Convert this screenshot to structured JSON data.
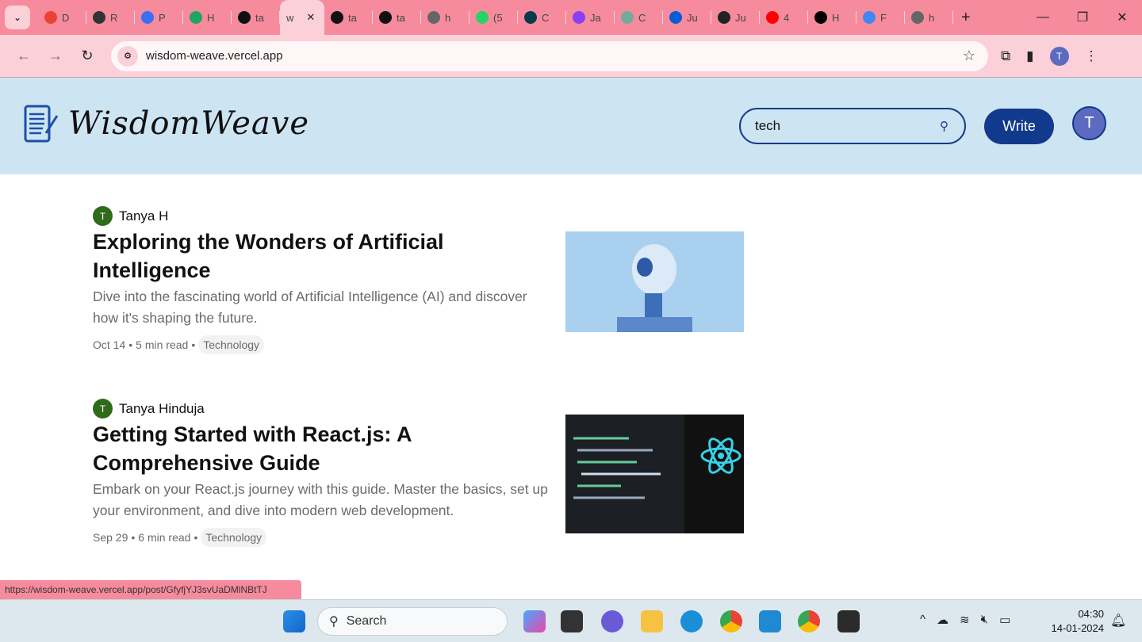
{
  "browser": {
    "tabs": [
      {
        "label": "D",
        "icon": "gmail-icon",
        "color": "#ea4335"
      },
      {
        "label": "R",
        "icon": "app-icon",
        "color": "#333333"
      },
      {
        "label": "P",
        "icon": "doc-icon",
        "color": "#3b6ef5"
      },
      {
        "label": "H",
        "icon": "google-drive-icon",
        "color": "#1fa463"
      },
      {
        "label": "ta",
        "icon": "github-icon",
        "color": "#111111"
      },
      {
        "label": "w",
        "icon": "",
        "color": "",
        "active": true
      },
      {
        "label": "ta",
        "icon": "github-icon",
        "color": "#111111"
      },
      {
        "label": "ta",
        "icon": "github-icon",
        "color": "#111111"
      },
      {
        "label": "h",
        "icon": "globe-icon",
        "color": "#666666"
      },
      {
        "label": "(5",
        "icon": "whatsapp-icon",
        "color": "#25d366"
      },
      {
        "label": "C",
        "icon": "react-icon",
        "color": "#0b3a4a"
      },
      {
        "label": "Ja",
        "icon": "app-icon",
        "color": "#8a3ff5"
      },
      {
        "label": "C",
        "icon": "chatgpt-icon",
        "color": "#74aa9c"
      },
      {
        "label": "Ju",
        "icon": "app-icon",
        "color": "#0a5bd8"
      },
      {
        "label": "Ju",
        "icon": "app-icon",
        "color": "#222222"
      },
      {
        "label": "4",
        "icon": "youtube-icon",
        "color": "#ff0000"
      },
      {
        "label": "H",
        "icon": "app-icon",
        "color": "#000000"
      },
      {
        "label": "F",
        "icon": "google-icon",
        "color": "#4285f4"
      },
      {
        "label": "h",
        "icon": "globe-icon",
        "color": "#666666"
      }
    ],
    "url": "wisdom-weave.vercel.app",
    "profile_initial": "T",
    "status_url": "https://wisdom-weave.vercel.app/post/GfyfjYJ3svUaDMlNBtTJ"
  },
  "header": {
    "logo_text": "WisdomWeave",
    "search_value": "tech",
    "write_label": "Write",
    "avatar_initial": "T"
  },
  "posts": [
    {
      "author": "Tanya H",
      "author_initial": "T",
      "title": "Exploring the Wonders of Artificial Intelligence",
      "description": "Dive into the fascinating world of Artificial Intelligence (AI) and discover how it's shaping the future.",
      "date": "Oct 14",
      "read_time": "5 min read",
      "tag": "Technology"
    },
    {
      "author": "Tanya Hinduja",
      "author_initial": "T",
      "title": "Getting Started with React.js: A Comprehensive Guide",
      "description": "Embark on your React.js journey with this guide. Master the basics, set up your environment, and dive into modern web development.",
      "date": "Sep 29",
      "read_time": "6 min read",
      "tag": "Technology"
    }
  ],
  "taskbar": {
    "search_label": "Search",
    "time": "04:30",
    "date": "14-01-2024"
  },
  "colors": {
    "accent": "#123a8c",
    "header_bg": "#cde4f3",
    "chrome_tab_bar": "#f78b9e"
  }
}
